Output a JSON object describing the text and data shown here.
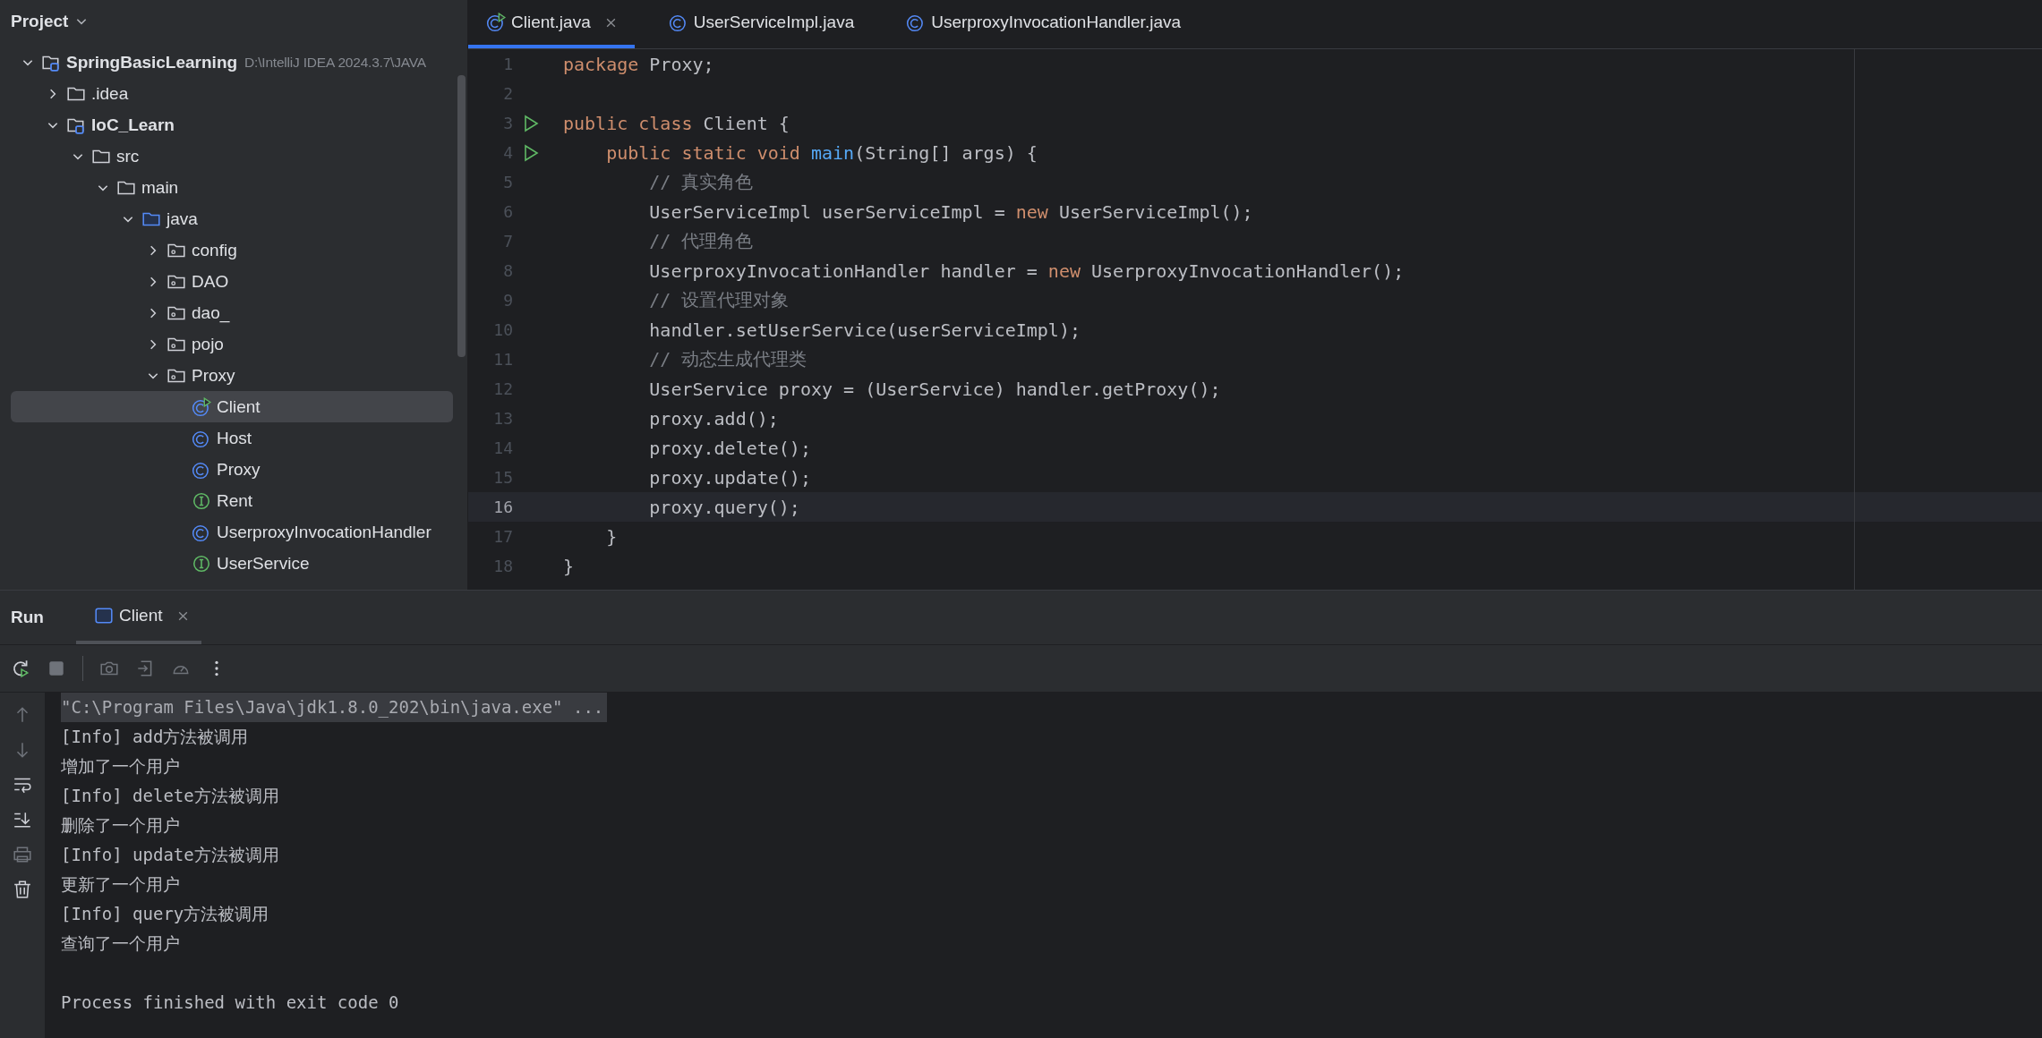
{
  "project_panel": {
    "title": "Project",
    "tree": [
      {
        "label": "SpringBasicLearning",
        "path": "D:\\IntelliJ IDEA 2024.3.7\\JAVA",
        "kind": "module",
        "expanded": true,
        "selected": false,
        "children": [
          {
            "label": ".idea",
            "kind": "folder",
            "expanded": false,
            "selected": false
          },
          {
            "label": "IoC_Learn",
            "kind": "module",
            "expanded": true,
            "selected": false,
            "children": [
              {
                "label": "src",
                "kind": "folder",
                "expanded": true,
                "selected": false,
                "children": [
                  {
                    "label": "main",
                    "kind": "folder",
                    "expanded": true,
                    "selected": false,
                    "children": [
                      {
                        "label": "java",
                        "kind": "source-folder",
                        "expanded": true,
                        "selected": false,
                        "children": [
                          {
                            "label": "config",
                            "kind": "package",
                            "expanded": false,
                            "selected": false
                          },
                          {
                            "label": "DAO",
                            "kind": "package",
                            "expanded": false,
                            "selected": false
                          },
                          {
                            "label": "dao_",
                            "kind": "package",
                            "expanded": false,
                            "selected": false
                          },
                          {
                            "label": "pojo",
                            "kind": "package",
                            "expanded": false,
                            "selected": false
                          },
                          {
                            "label": "Proxy",
                            "kind": "package",
                            "expanded": true,
                            "selected": false,
                            "children": [
                              {
                                "label": "Client",
                                "kind": "class-run",
                                "selected": true
                              },
                              {
                                "label": "Host",
                                "kind": "class",
                                "selected": false
                              },
                              {
                                "label": "Proxy",
                                "kind": "class",
                                "selected": false
                              },
                              {
                                "label": "Rent",
                                "kind": "interface",
                                "selected": false
                              },
                              {
                                "label": "UserproxyInvocationHandler",
                                "kind": "class",
                                "selected": false
                              },
                              {
                                "label": "UserService",
                                "kind": "interface",
                                "selected": false
                              }
                            ]
                          }
                        ]
                      }
                    ]
                  }
                ]
              }
            ]
          }
        ]
      }
    ]
  },
  "editor": {
    "tabs": [
      {
        "label": "Client.java",
        "kind": "class-run",
        "selected": true
      },
      {
        "label": "UserServiceImpl.java",
        "kind": "class",
        "selected": false
      },
      {
        "label": "UserproxyInvocationHandler.java",
        "kind": "class",
        "selected": false
      }
    ],
    "lines": [
      {
        "number": "1",
        "runnable": false,
        "current": false,
        "tokens": [
          {
            "text": "package",
            "kind": "keyword"
          },
          {
            "text": " Proxy;",
            "kind": "plain"
          }
        ]
      },
      {
        "number": "2",
        "runnable": false,
        "current": false
      },
      {
        "number": "3",
        "runnable": true,
        "current": false,
        "tokens": [
          {
            "text": "public class",
            "kind": "keyword"
          },
          {
            "text": " Client {",
            "kind": "plain"
          }
        ]
      },
      {
        "number": "4",
        "runnable": true,
        "current": false,
        "tokens": [
          {
            "text": "    public static void ",
            "kind": "keyword"
          },
          {
            "text": "main",
            "kind": "function"
          },
          {
            "text": "(String[] args) {",
            "kind": "plain"
          }
        ]
      },
      {
        "number": "5",
        "runnable": false,
        "current": false,
        "tokens": [
          {
            "text": "        // 真实角色",
            "kind": "comment"
          }
        ]
      },
      {
        "number": "6",
        "runnable": false,
        "current": false,
        "tokens": [
          {
            "text": "        UserServiceImpl userServiceImpl = ",
            "kind": "plain"
          },
          {
            "text": "new",
            "kind": "keyword"
          },
          {
            "text": " UserServiceImpl();",
            "kind": "plain"
          }
        ]
      },
      {
        "number": "7",
        "runnable": false,
        "current": false,
        "tokens": [
          {
            "text": "        // 代理角色",
            "kind": "comment"
          }
        ]
      },
      {
        "number": "8",
        "runnable": false,
        "current": false,
        "tokens": [
          {
            "text": "        UserproxyInvocationHandler handler = ",
            "kind": "plain"
          },
          {
            "text": "new",
            "kind": "keyword"
          },
          {
            "text": " UserproxyInvocationHandler();",
            "kind": "plain"
          }
        ]
      },
      {
        "number": "9",
        "runnable": false,
        "current": false,
        "tokens": [
          {
            "text": "        // 设置代理对象",
            "kind": "comment"
          }
        ]
      },
      {
        "number": "10",
        "runnable": false,
        "current": false,
        "tokens": [
          {
            "text": "        handler.setUserService(userServiceImpl);",
            "kind": "plain"
          }
        ]
      },
      {
        "number": "11",
        "runnable": false,
        "current": false,
        "tokens": [
          {
            "text": "        // 动态生成代理类",
            "kind": "comment"
          }
        ]
      },
      {
        "number": "12",
        "runnable": false,
        "current": false,
        "tokens": [
          {
            "text": "        UserService proxy = (UserService) handler.getProxy();",
            "kind": "plain"
          }
        ]
      },
      {
        "number": "13",
        "runnable": false,
        "current": false,
        "tokens": [
          {
            "text": "        proxy.add();",
            "kind": "plain"
          }
        ]
      },
      {
        "number": "14",
        "runnable": false,
        "current": false,
        "tokens": [
          {
            "text": "        proxy.delete();",
            "kind": "plain"
          }
        ]
      },
      {
        "number": "15",
        "runnable": false,
        "current": false,
        "tokens": [
          {
            "text": "        proxy.update();",
            "kind": "plain"
          }
        ]
      },
      {
        "number": "16",
        "runnable": false,
        "current": true,
        "tokens": [
          {
            "text": "        proxy.query();",
            "kind": "plain"
          }
        ]
      },
      {
        "number": "17",
        "runnable": false,
        "current": false,
        "tokens": [
          {
            "text": "    }",
            "kind": "plain"
          }
        ]
      },
      {
        "number": "18",
        "runnable": false,
        "current": false,
        "tokens": [
          {
            "text": "}",
            "kind": "plain"
          }
        ]
      }
    ]
  },
  "run_panel": {
    "title": "Run",
    "tabs": [
      {
        "label": "Client",
        "selected": true
      }
    ],
    "toolbar": [
      {
        "kind": "rerun",
        "disabled": false
      },
      {
        "kind": "stop",
        "disabled": true
      },
      {
        "kind": "separator"
      },
      {
        "kind": "camera",
        "disabled": true
      },
      {
        "kind": "exit",
        "disabled": true
      },
      {
        "kind": "gauge",
        "disabled": true
      },
      {
        "kind": "more",
        "disabled": false
      }
    ],
    "side_tools": [
      {
        "kind": "up",
        "disabled": true
      },
      {
        "kind": "down",
        "disabled": true
      },
      {
        "kind": "wrap",
        "disabled": false
      },
      {
        "kind": "scroll-end",
        "disabled": false
      },
      {
        "kind": "print",
        "disabled": true
      },
      {
        "kind": "trash",
        "disabled": false
      }
    ],
    "console": [
      {
        "text": "\"C:\\Program Files\\Java\\jdk1.8.0_202\\bin\\java.exe\" ...",
        "kind": "command"
      },
      {
        "text": "[Info] add方法被调用",
        "kind": "output"
      },
      {
        "text": "增加了一个用户",
        "kind": "output"
      },
      {
        "text": "[Info] delete方法被调用",
        "kind": "output"
      },
      {
        "text": "删除了一个用户",
        "kind": "output"
      },
      {
        "text": "[Info] update方法被调用",
        "kind": "output"
      },
      {
        "text": "更新了一个用户",
        "kind": "output"
      },
      {
        "text": "[Info] query方法被调用",
        "kind": "output"
      },
      {
        "text": "查询了一个用户",
        "kind": "output"
      },
      {
        "text": "Process finished with exit code 0",
        "kind": "exit"
      }
    ]
  }
}
